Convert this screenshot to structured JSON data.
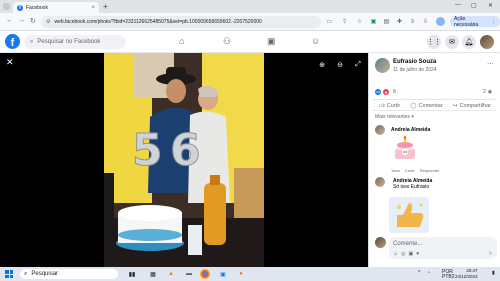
{
  "browser": {
    "tab_title": "Facebook",
    "url": "web.facebook.com/photo/?fbid=2331126625485075&set=pb.100009656659602.-2207520000",
    "update_button": "Ação necessária"
  },
  "facebook": {
    "search_placeholder": "Pesquisar no Facebook"
  },
  "post": {
    "author": "Eufrasio Souza",
    "date": "11 de julho de 2024",
    "reaction_count": "8",
    "comment_count": "2",
    "actions": [
      "Curtir",
      "Comentar",
      "Compartilhar"
    ],
    "sort_label": "Mais relevantes",
    "comments": [
      {
        "name": "Andreia Almeida",
        "links": [
          "1ano",
          "Curtir",
          "Responder"
        ]
      },
      {
        "name": "Andreia Almeida",
        "text": "Só isso Eufrasio"
      }
    ],
    "comment_placeholder": "Comente..."
  },
  "taskbar": {
    "search_placeholder": "Pesquisar",
    "language": "POR",
    "language2": "PTB2",
    "time": "20:47",
    "date": "24/12/2023"
  },
  "colors": {
    "facebook_blue": "#1877f2",
    "like_blue": "#1877f2",
    "love_red": "#f33e58"
  }
}
